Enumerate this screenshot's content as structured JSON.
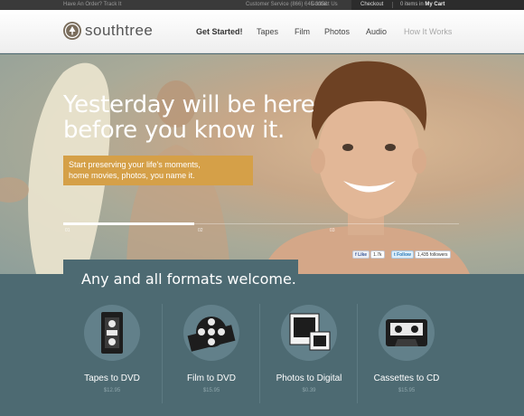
{
  "topbar": {
    "order_prompt": "Have An Order? Track It",
    "service": "Customer Service (866) 645-3358",
    "contact": "Contact Us",
    "checkout": "Checkout",
    "cart_count": "0 items in",
    "cart_label": "My Cart"
  },
  "header": {
    "logo_text": "southtree",
    "nav": [
      {
        "label": "Get Started!",
        "state": "active"
      },
      {
        "label": "Tapes"
      },
      {
        "label": "Film"
      },
      {
        "label": "Photos"
      },
      {
        "label": "Audio"
      },
      {
        "label": "How It Works",
        "state": "muted"
      }
    ]
  },
  "hero": {
    "headline_line1": "Yesterday will be here",
    "headline_line2": "before you know it.",
    "tagline_line1": "Start preserving your life's moments,",
    "tagline_line2": "home movies, photos, you name it.",
    "slides": [
      "01",
      "02",
      "03"
    ],
    "active_slide": 1,
    "slider_progress": 0.33,
    "social": {
      "facebook_label": "Like",
      "facebook_count": "1.7k",
      "twitter_label": "Follow",
      "twitter_count": "1,435 followers"
    }
  },
  "formats": {
    "title": "Any and all formats welcome.",
    "items": [
      {
        "label": "Tapes to DVD",
        "price": "$12.95",
        "icon": "vhs-tape-icon"
      },
      {
        "label": "Film to DVD",
        "price": "$15.95",
        "icon": "film-reel-icon"
      },
      {
        "label": "Photos to Digital",
        "price": "$0.39",
        "icon": "photo-slide-icon"
      },
      {
        "label": "Cassettes to CD",
        "price": "$15.95",
        "icon": "cassette-icon"
      }
    ]
  },
  "colors": {
    "accent": "#d5a048",
    "section_bg": "#4d6a72",
    "topbar_bg": "#3a3a3a"
  }
}
